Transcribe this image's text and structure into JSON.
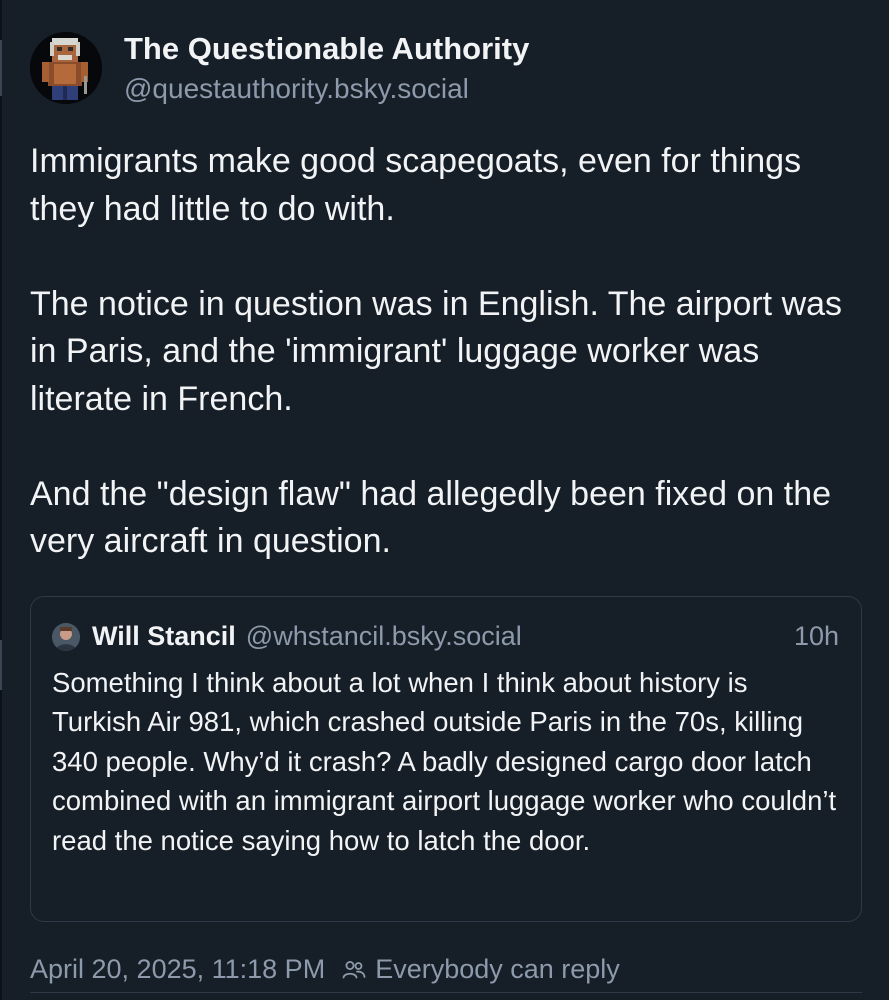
{
  "post": {
    "author": {
      "display_name": "The Questionable Authority",
      "handle": "@questauthority.bsky.social"
    },
    "paragraphs": [
      "Immigrants make good scapegoats, even for things they had little to do with.",
      "The notice in question was in English. The airport was in Paris, and the 'immigrant' luggage worker was literate in French.",
      "And the \"design flaw\" had allegedly been fixed on the very aircraft in question."
    ],
    "quote": {
      "display_name": "Will Stancil",
      "handle": "@whstancil.bsky.social",
      "time": "10h",
      "text": "Something I think about a lot when I think about history is Turkish Air 981, which crashed outside Paris in the 70s, killing 340 people. Why’d it crash? A badly designed cargo door latch combined with an immigrant airport luggage worker who couldn’t read the notice saying how to latch the door."
    },
    "timestamp": "April 20, 2025, 11:18 PM",
    "reply_setting": "Everybody can reply",
    "icons": {
      "reply_setting_icon": "people-icon"
    }
  },
  "colors": {
    "background": "#161e27",
    "text_primary": "#f1f3f5",
    "text_secondary": "#8d9aab",
    "border": "#2e3a47"
  }
}
